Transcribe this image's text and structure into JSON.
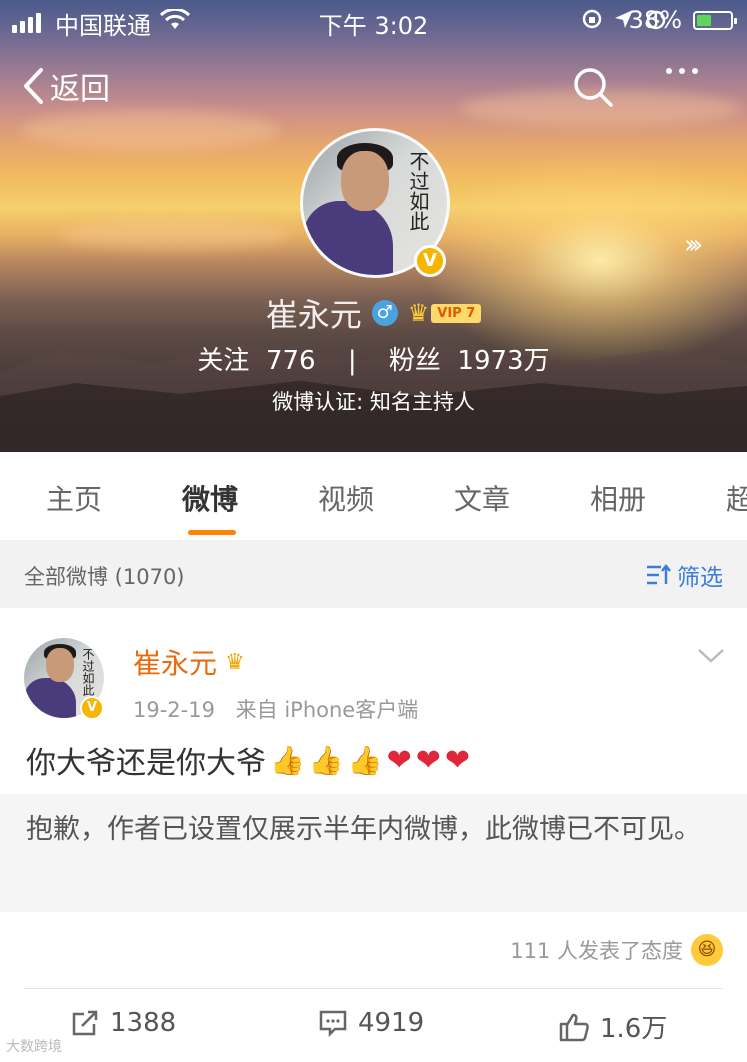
{
  "status_bar": {
    "carrier": "中国联通",
    "time": "下午 3:02",
    "battery": "38%"
  },
  "nav": {
    "back_label": "返回"
  },
  "profile": {
    "avatar_text": "不过如此",
    "name": "崔永元",
    "vip_level": "VIP 7",
    "following_label": "关注",
    "following_count": "776",
    "separator": "|",
    "followers_label": "粉丝",
    "followers_count": "1973万",
    "verification": "微博认证: 知名主持人"
  },
  "tabs": [
    {
      "label": "主页"
    },
    {
      "label": "微博"
    },
    {
      "label": "视频"
    },
    {
      "label": "文章"
    },
    {
      "label": "相册"
    },
    {
      "label": "超"
    }
  ],
  "filter": {
    "count_label": "全部微博 (1070)",
    "filter_label": "筛选"
  },
  "post": {
    "author": "崔永元",
    "date": "19-2-19",
    "source": "来自 iPhone客户端",
    "text": "你大爷还是你大爷",
    "emojis": [
      "👍",
      "👍",
      "👍",
      "❤",
      "❤",
      "❤"
    ],
    "hidden_notice": "抱歉，作者已设置仅展示半年内微博，此微博已不可见。",
    "reactions": "111 人发表了态度",
    "reposts": "1388",
    "comments": "4919",
    "likes": "1.6万"
  },
  "watermark": "大数跨境",
  "colors": {
    "accent_orange": "#ff8200",
    "name_orange": "#e86b0c",
    "link_blue": "#3b7ed7",
    "verified_gold": "#f7b500"
  }
}
